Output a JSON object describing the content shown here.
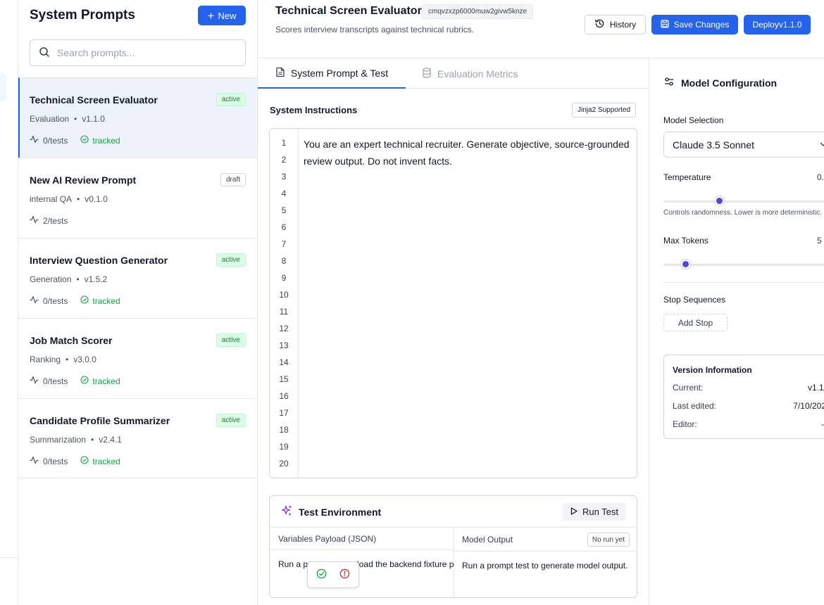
{
  "sidebar": {
    "title": "System Prompts",
    "new_label": "New",
    "search_placeholder": "Search prompts...",
    "items": [
      {
        "name": "Technical Screen Evaluator",
        "category": "Evaluation",
        "version": "v1.1.0",
        "tests": "0/tests",
        "tracked": "tracked",
        "status": "active"
      },
      {
        "name": "New AI Review Prompt",
        "category": "internal QA",
        "version": "v0.1.0",
        "tests": "2/tests",
        "tracked": "",
        "status": "draft"
      },
      {
        "name": "Interview Question Generator",
        "category": "Generation",
        "version": "v1.5.2",
        "tests": "0/tests",
        "tracked": "tracked",
        "status": "active"
      },
      {
        "name": "Job Match Scorer",
        "category": "Ranking",
        "version": "v3.0.0",
        "tests": "0/tests",
        "tracked": "tracked",
        "status": "active"
      },
      {
        "name": "Candidate Profile Summarizer",
        "category": "Summarization",
        "version": "v2.4.1",
        "tests": "0/tests",
        "tracked": "tracked",
        "status": "active"
      }
    ]
  },
  "header": {
    "title": "Technical Screen Evaluator",
    "id": "cmqvzxzp6000muw2givw5knze",
    "description": "Scores interview transcripts against technical rubrics.",
    "history_label": "History",
    "save_label": "Save Changes",
    "deploy_label": "Deployv1.1.0"
  },
  "tabs": [
    {
      "label": "System Prompt & Test",
      "active": true
    },
    {
      "label": "Evaluation Metrics",
      "active": false
    }
  ],
  "editor": {
    "title": "System Instructions",
    "badge": "Jinja2 Supported",
    "line_numbers": [
      "1",
      "2",
      "3",
      "4",
      "5",
      "6",
      "7",
      "8",
      "9",
      "10",
      "11",
      "12",
      "13",
      "14",
      "15",
      "16",
      "17",
      "18",
      "19",
      "20"
    ],
    "content": "You are an expert technical recruiter. Generate objective, source-grounded review output. Do not invent facts."
  },
  "test_env": {
    "title": "Test Environment",
    "run_label": "Run Test",
    "variables_label": "Variables Payload (JSON)",
    "variables_text": "Run a prompt test to load the backend fixture payload.",
    "output_label": "Model Output",
    "output_badge": "No run yet",
    "output_text": "Run a prompt test to generate model output."
  },
  "config": {
    "title": "Model Configuration",
    "model_label": "Model Selection",
    "model_value": "Claude 3.5 Sonnet",
    "temperature_label": "Temperature",
    "temperature_value": "0.",
    "temperature_level": 0.33,
    "temperature_hint": "Controls randomness. Lower is more deterministic.",
    "max_tokens_label": "Max Tokens",
    "max_tokens_value": "5",
    "max_tokens_level": 0.13,
    "stop_label": "Stop Sequences",
    "add_stop_label": "Add Stop",
    "version_title": "Version Information",
    "version_rows": [
      {
        "label": "Current:",
        "value": "v1.1."
      },
      {
        "label": "Last edited:",
        "value": "7/10/202"
      },
      {
        "label": "Editor:",
        "value": "–"
      }
    ]
  },
  "colors": {
    "accent": "#2563eb",
    "active_badge_bg": "#dcfce7",
    "active_badge_text": "#15803d",
    "slider": "#4f46e5",
    "sparkle": "#7c3aed"
  }
}
